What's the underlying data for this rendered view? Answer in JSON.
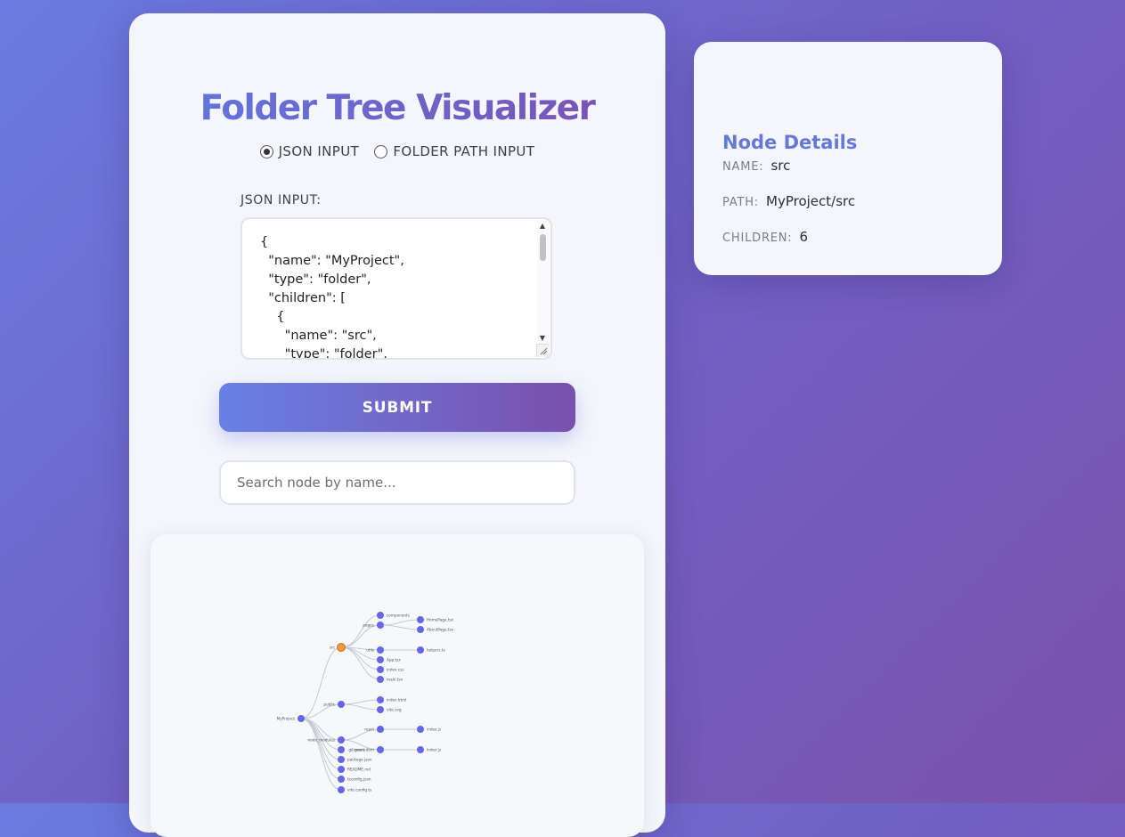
{
  "title": "Folder Tree Visualizer",
  "input_mode": {
    "options": [
      {
        "label": "JSON INPUT",
        "checked": true
      },
      {
        "label": "FOLDER PATH INPUT",
        "checked": false
      }
    ]
  },
  "json_input": {
    "label": "JSON INPUT:",
    "value": "{\n  \"name\": \"MyProject\",\n  \"type\": \"folder\",\n  \"children\": [\n    {\n      \"name\": \"src\",\n      \"type\": \"folder\","
  },
  "submit_label": "SUBMIT",
  "search": {
    "placeholder": "Search node by name..."
  },
  "tree": {
    "nodes": [
      {
        "id": "root",
        "label": "MyProject"
      },
      {
        "id": "src",
        "label": "src",
        "selected": true
      },
      {
        "id": "components",
        "label": "components"
      },
      {
        "id": "pages",
        "label": "pages"
      },
      {
        "id": "homepage",
        "label": "HomePage.tsx"
      },
      {
        "id": "aboutpage",
        "label": "AboutPage.tsx"
      },
      {
        "id": "utils",
        "label": "utils"
      },
      {
        "id": "helpers",
        "label": "helpers.ts"
      },
      {
        "id": "app",
        "label": "App.tsx"
      },
      {
        "id": "indexcss",
        "label": "index.css"
      },
      {
        "id": "maintsx",
        "label": "main.tsx"
      },
      {
        "id": "public",
        "label": "public"
      },
      {
        "id": "indexhtml",
        "label": "index.html"
      },
      {
        "id": "vitesvg",
        "label": "vite.svg"
      },
      {
        "id": "nodemodules",
        "label": "node_modules"
      },
      {
        "id": "react",
        "label": "react"
      },
      {
        "id": "reactindex",
        "label": "index.js"
      },
      {
        "id": "gitignore",
        "label": ".gitignore"
      },
      {
        "id": "reactdom",
        "label": "react-dom"
      },
      {
        "id": "reactdomindex",
        "label": "index.js"
      },
      {
        "id": "packagejson",
        "label": "package.json"
      },
      {
        "id": "readme",
        "label": "README.md"
      },
      {
        "id": "tsconfig",
        "label": "tsconfig.json"
      },
      {
        "id": "viteconfig",
        "label": "vite.config.ts"
      }
    ]
  },
  "node_details": {
    "title": "Node Details",
    "name_label": "NAME:",
    "name_value": "src",
    "path_label": "PATH:",
    "path_value": "MyProject/src",
    "children_label": "CHILDREN:",
    "children_value": "6"
  },
  "colors": {
    "node": "#6566e8",
    "selected_node": "#f29a3a",
    "link": "#c5c8d0"
  }
}
